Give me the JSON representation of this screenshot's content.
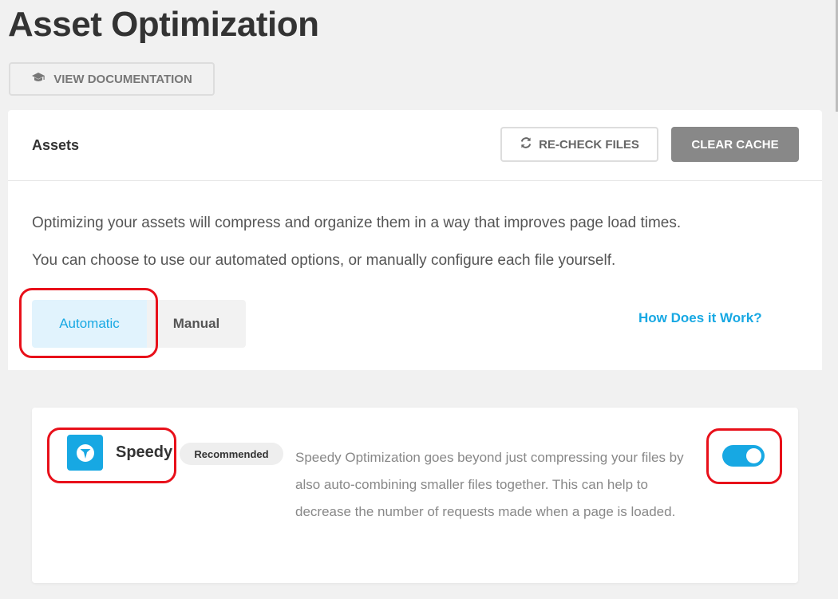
{
  "header": {
    "title": "Asset Optimization",
    "doc_button_label": "VIEW DOCUMENTATION",
    "doc_button_icon": "graduation-cap-icon"
  },
  "assets_card": {
    "title": "Assets",
    "recheck_label": "RE-CHECK FILES",
    "recheck_icon": "refresh-icon",
    "clear_cache_label": "CLEAR CACHE",
    "description_line1": "Optimizing your assets will compress and organize them in a way that improves page load times.",
    "description_line2": "You can choose to use our automated options, or manually configure each file yourself.",
    "tabs": [
      {
        "label": "Automatic",
        "active": true
      },
      {
        "label": "Manual",
        "active": false
      }
    ],
    "help_link": "How Does it Work?"
  },
  "speedy": {
    "name": "Speedy",
    "badge": "Recommended",
    "description": "Speedy Optimization goes beyond just compressing your files by also auto-combining smaller files together. This can help to decrease the number of requests made when a page is loaded.",
    "enabled": true,
    "logo_icon": "speedy-logo-icon"
  },
  "colors": {
    "accent": "#17a8e3",
    "highlight": "#e8101a",
    "clear_cache_bg": "#888888"
  }
}
